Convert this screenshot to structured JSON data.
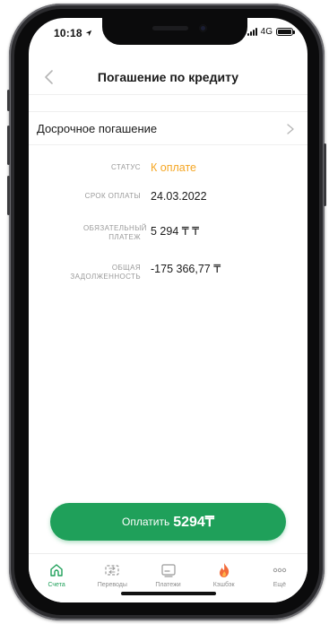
{
  "status_bar": {
    "time": "10:18",
    "network": "4G"
  },
  "header": {
    "title": "Погашение по кредиту"
  },
  "menu": {
    "early_repayment_label": "Досрочное погашение"
  },
  "details": [
    {
      "label": "СТАТУС",
      "value": "К оплате",
      "accent": true
    },
    {
      "label": "СРОК ОПЛАТЫ",
      "value": "24.03.2022",
      "accent": false
    },
    {
      "label": "ОБЯЗАТЕЛЬНЫЙ ПЛАТЕЖ",
      "value": "5 294 ₸ ₸",
      "accent": false
    },
    {
      "label": "ОБЩАЯ ЗАДОЛЖЕННОСТЬ",
      "value": "-175 366,77 ₸",
      "accent": false
    }
  ],
  "pay_button": {
    "label": "Оплатить",
    "amount": "5294₸"
  },
  "tabs": [
    {
      "label": "Счета",
      "icon": "home-icon",
      "active": true
    },
    {
      "label": "Переводы",
      "icon": "transfer-icon",
      "active": false
    },
    {
      "label": "Платежи",
      "icon": "payments-icon",
      "active": false
    },
    {
      "label": "Кэшбэк",
      "icon": "fire-icon",
      "active": false
    },
    {
      "label": "Ещё",
      "icon": "more-icon",
      "active": false
    }
  ],
  "colors": {
    "accent_green": "#1fa05a",
    "status_orange": "#f5a623",
    "cashback_orange": "#f26b3a"
  }
}
